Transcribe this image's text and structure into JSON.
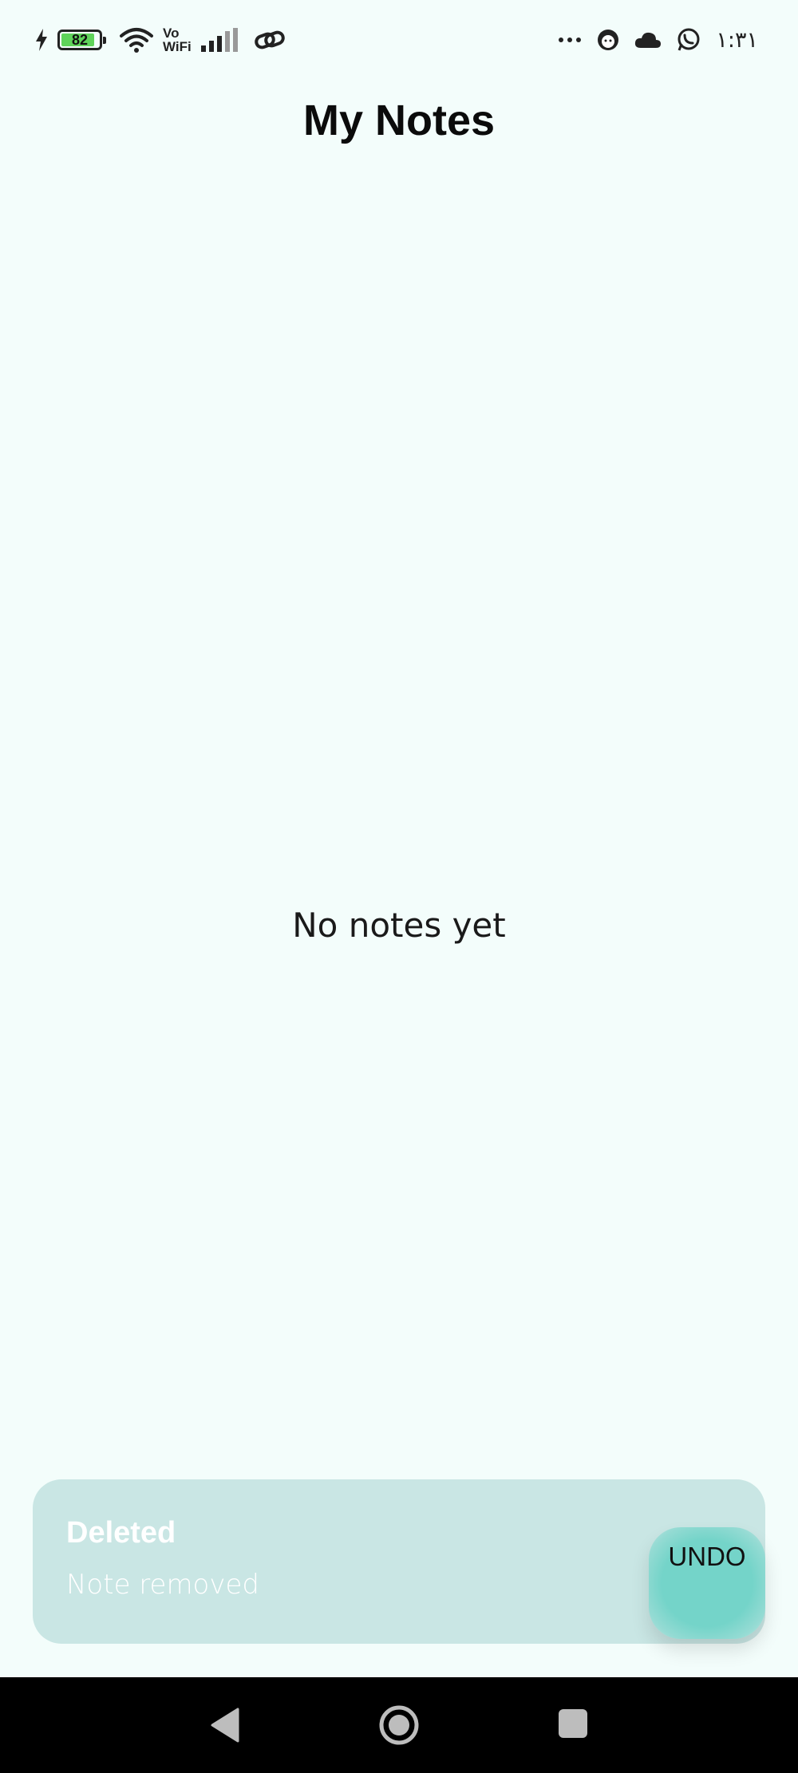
{
  "status_bar": {
    "battery_level": "82",
    "vowifi_top": "Vo",
    "vowifi_bottom": "WiFi",
    "clock": "١:٣١"
  },
  "header": {
    "title": "My Notes"
  },
  "main": {
    "empty_message": "No notes yet"
  },
  "snackbar": {
    "title": "Deleted",
    "message": "Note removed",
    "action_label": "UNDO"
  },
  "colors": {
    "background": "#f3fdfb",
    "snackbar": "#c9e6e4",
    "accent": "#74d4c9"
  }
}
